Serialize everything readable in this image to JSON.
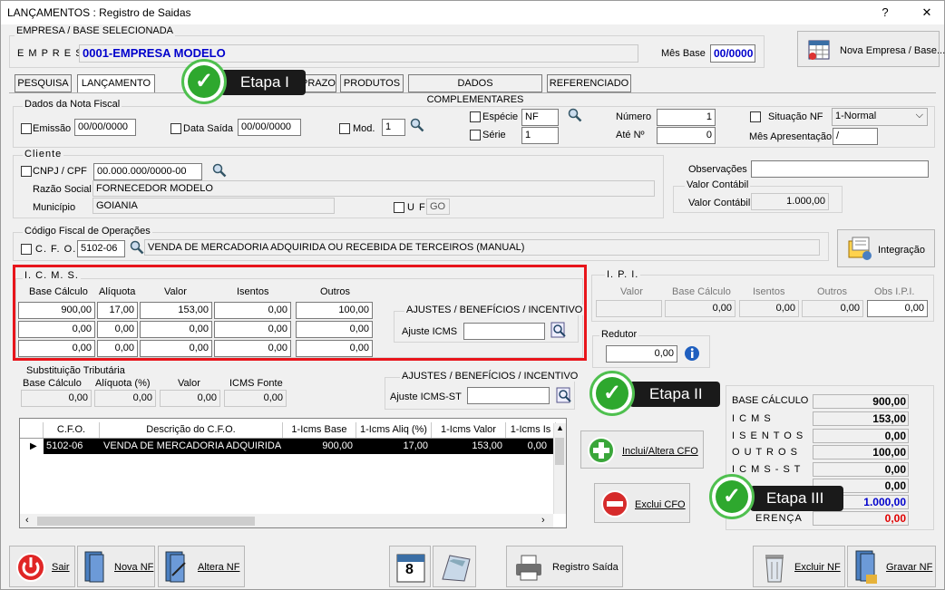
{
  "window": {
    "title": "LANÇAMENTOS : Registro de Saidas",
    "help": "?",
    "close": "✕"
  },
  "empresa": {
    "group": "EMPRESA / BASE SELECIONADA",
    "label": "E M P R E S A",
    "value": "0001-EMPRESA MODELO",
    "mes_base_label": "Mês Base",
    "mes_base": "00/0000",
    "nova_btn": "Nova Empresa / Base..."
  },
  "tabs": [
    "PESQUISA",
    "LANÇAMENTO",
    "PRAZO",
    "PRODUTOS",
    "DADOS COMPLEMENTARES",
    "REFERENCIADO"
  ],
  "nota": {
    "group": "Dados da Nota Fiscal",
    "emissao_label": "Emissão",
    "emissao": "00/00/0000",
    "data_saida_label": "Data Saída",
    "data_saida": "00/00/0000",
    "mod_label": "Mod.",
    "mod": "1",
    "especie_label": "Espécie",
    "especie": "NF",
    "serie_label": "Série",
    "serie": "1",
    "numero_label": "Número",
    "numero": "1",
    "ate_label": "Até Nº",
    "ate": "0",
    "situacao_label": "Situação NF",
    "situacao": "1-Normal",
    "mes_apres_label": "Mês Apresentação",
    "mes_apres": "/"
  },
  "cliente": {
    "group": "Cliente",
    "cnpj_label": "CNPJ / CPF",
    "cnpj": "00.000.000/0000-00",
    "razao_label": "Razão Social",
    "razao": "FORNECEDOR MODELO",
    "municipio_label": "Município",
    "municipio": "GOIANIA",
    "uf_label": "U F",
    "uf": "GO",
    "obs_label": "Observações",
    "obs": "",
    "vc_group": "Valor Contábil",
    "vc_label": "Valor Contábil",
    "vc": "1.000,00"
  },
  "cfo": {
    "group": "Código Fiscal de Operações",
    "label": "C. F. O.",
    "code": "5102-06",
    "desc": "VENDA DE MERCADORIA ADQUIRIDA OU RECEBIDA DE TERCEIROS (MANUAL)",
    "integ_btn": "Integração"
  },
  "icms": {
    "group": "I. C. M. S.",
    "headers": [
      "Base Cálculo",
      "Alíquota",
      "Valor",
      "Isentos",
      "Outros"
    ],
    "rows": [
      [
        "900,00",
        "17,00",
        "153,00",
        "0,00",
        "100,00"
      ],
      [
        "0,00",
        "0,00",
        "0,00",
        "0,00",
        "0,00"
      ],
      [
        "0,00",
        "0,00",
        "0,00",
        "0,00",
        "0,00"
      ]
    ],
    "aj_group": "AJUSTES / BENEFÍCIOS / INCENTIVO",
    "aj_label": "Ajuste ICMS",
    "aj": ""
  },
  "ipi": {
    "group": "I. P. I.",
    "headers": [
      "Valor",
      "Base Cálculo",
      "Isentos",
      "Outros",
      "Obs I.P.I."
    ],
    "values": [
      "",
      "0,00",
      "0,00",
      "0,00",
      "0,00"
    ],
    "redutor_group": "Redutor",
    "redutor": "0,00"
  },
  "st": {
    "group": "Substituição Tributária",
    "headers": [
      "Base Cálculo",
      "Alíquota (%)",
      "Valor",
      "ICMS Fonte"
    ],
    "values": [
      "0,00",
      "0,00",
      "0,00",
      "0,00"
    ],
    "aj_group": "AJUSTES / BENEFÍCIOS / INCENTIVO",
    "aj_label": "Ajuste ICMS-ST",
    "aj": ""
  },
  "grid": {
    "headers": [
      "C.F.O.",
      "Descrição do C.F.O.",
      "1-Icms Base",
      "1-Icms Aliq (%)",
      "1-Icms Valor",
      "1-Icms Is"
    ],
    "row": [
      "5102-06",
      "VENDA DE MERCADORIA ADQUIRIDA OU",
      "900,00",
      "17,00",
      "153,00",
      "0,00"
    ]
  },
  "actions": {
    "inclui": "Inclui/Altera CFO",
    "exclui": "Exclui CFO"
  },
  "totais": [
    {
      "label": "BASE CÁLCULO",
      "value": "900,00"
    },
    {
      "label": "I C M S",
      "value": "153,00"
    },
    {
      "label": "I S E N T O S",
      "value": "0,00"
    },
    {
      "label": "O U T R O S",
      "value": "100,00"
    },
    {
      "label": "I C M S - S T",
      "value": "0,00"
    },
    {
      "label": "",
      "value": "0,00"
    },
    {
      "label": "",
      "value": "1.000,00"
    },
    {
      "label": "ERENÇA",
      "value": "0,00"
    }
  ],
  "bottom": {
    "sair": "Sair",
    "nova": "Nova NF",
    "altera": "Altera NF",
    "cal_day": "8",
    "registro": "Registro Saída",
    "excluir": "Excluir NF",
    "gravar": "Gravar NF"
  },
  "callouts": [
    "Etapa I",
    "Etapa II",
    "Etapa III"
  ],
  "colors": {
    "highlight": "#e8151b",
    "callout_bg": "#1a1a1a",
    "badge": "#2ea82e",
    "total_blue": "#0000cc",
    "total_red": "#e00000",
    "empresa_text": "#0000cc"
  }
}
